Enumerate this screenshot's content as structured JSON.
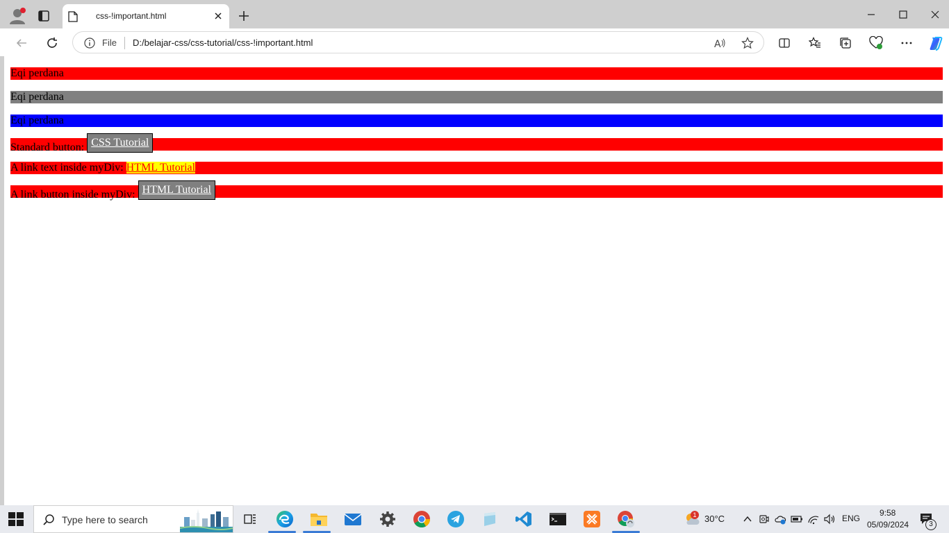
{
  "browser": {
    "tab_title": "css-!important.html",
    "url_scheme_label": "File",
    "url": "D:/belajar-css/css-tutorial/css-!important.html"
  },
  "page": {
    "lines": [
      {
        "text": "Eqi perdana"
      },
      {
        "text": "Eqi perdana"
      },
      {
        "text": "Eqi perdana"
      },
      {
        "prefix": "Standard button: ",
        "link": "CSS Tutorial"
      },
      {
        "prefix": "A link text inside myDiv: ",
        "link": "HTML Tutorial"
      },
      {
        "prefix": "A link button inside myDiv: ",
        "link": "HTML Tutorial"
      }
    ]
  },
  "taskbar": {
    "search_placeholder": "Type here to search",
    "weather_temp": "30°C",
    "weather_badge": "1",
    "language": "ENG",
    "time": "9:58",
    "date": "05/09/2024",
    "notification_count": "3"
  },
  "colors": {
    "red": "#ff0000",
    "gray": "#808080",
    "blue": "#0000ff",
    "yellow": "#ffff00"
  }
}
